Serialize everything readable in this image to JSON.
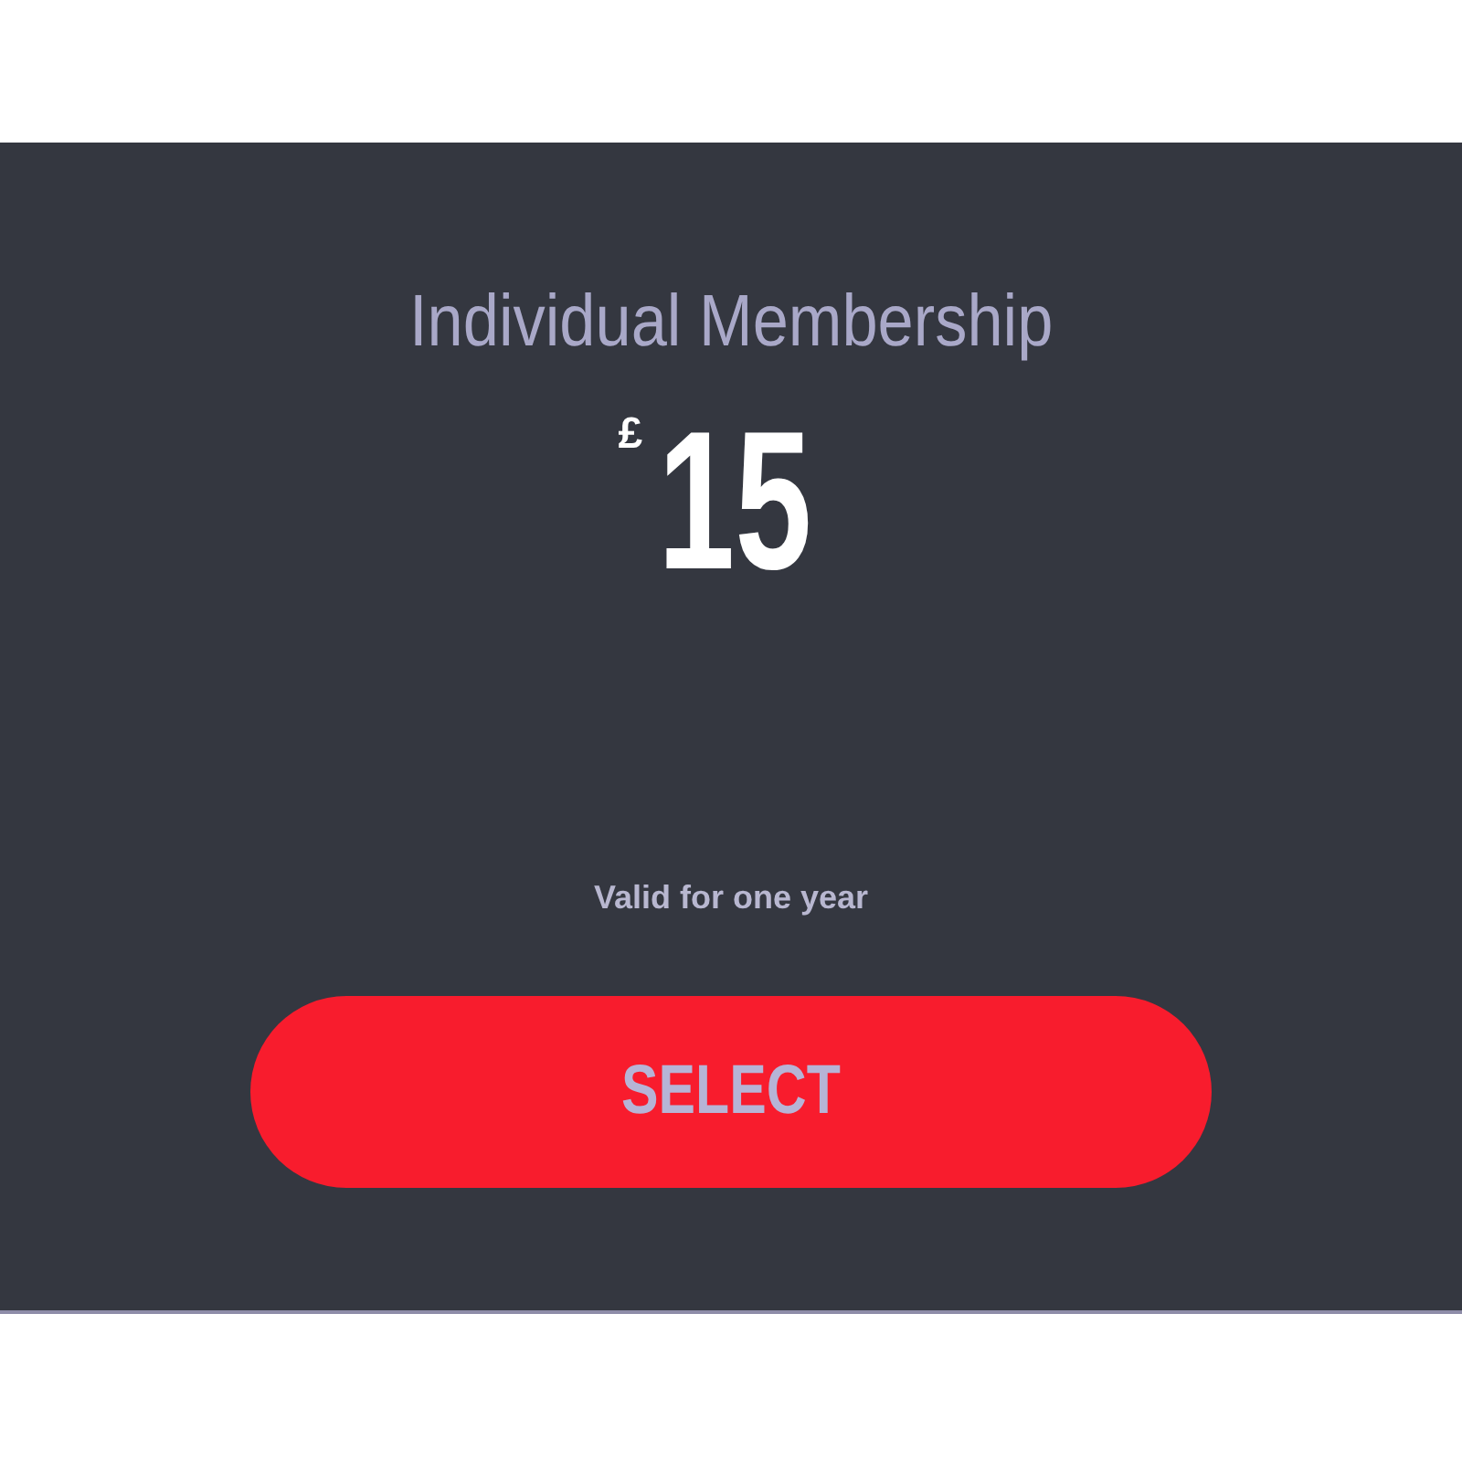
{
  "plan": {
    "title": "Individual Membership",
    "currency": "£",
    "amount": "15",
    "validity": "Valid for one year",
    "button": "SELECT"
  }
}
